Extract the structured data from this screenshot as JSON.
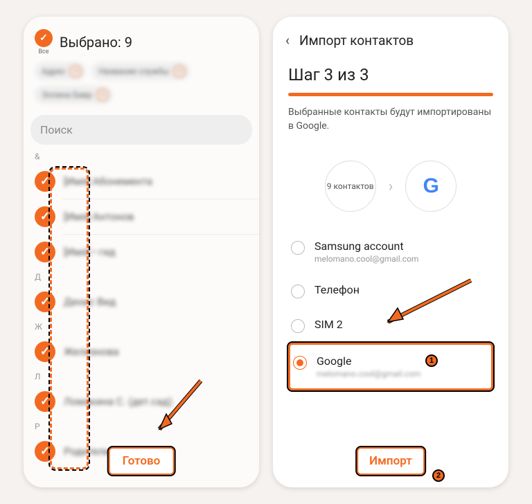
{
  "left": {
    "all_label": "Все",
    "selected_text": "Выбрано: 9",
    "chips": [
      "Адрес",
      "Название службы",
      "Эллина Бавр"
    ],
    "search_placeholder": "Поиск",
    "sections": [
      {
        "letter": "&",
        "items": [
          "[Имя] Абонемента",
          "[Имя] Антонов",
          "[Имя] • гид"
        ]
      },
      {
        "letter": "Д",
        "items": [
          "Денис Вид"
        ]
      },
      {
        "letter": "Ж",
        "items": [
          "Железнова"
        ]
      },
      {
        "letter": "Л",
        "items": [
          "Ломакина С. (дет.сад)"
        ]
      },
      {
        "letter": "Р",
        "items": [
          "Родители"
        ]
      }
    ],
    "done_label": "Готово"
  },
  "right": {
    "header_title": "Импорт контактов",
    "step_text": "Шаг 3 из 3",
    "info_text": "Выбранные контакты будут импортированы в Google.",
    "flow_count": "9 контактов",
    "accounts": [
      {
        "label": "Samsung account",
        "sub": "melomano.cool@gmail.com",
        "selected": false
      },
      {
        "label": "Телефон",
        "sub": "",
        "selected": false
      },
      {
        "label": "SIM 2",
        "sub": "",
        "selected": false
      },
      {
        "label": "Google",
        "sub": "",
        "selected": true
      }
    ],
    "import_label": "Импорт"
  },
  "badges": {
    "one": "1",
    "two": "2"
  }
}
